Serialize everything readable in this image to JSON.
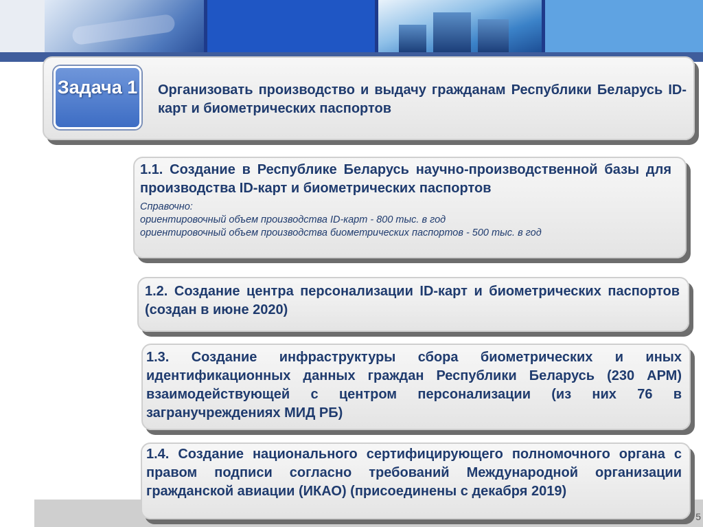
{
  "task": {
    "badge_label": "Задача 1",
    "text": "Организовать производство и выдачу гражданам Республики Беларусь ID-карт и биометрических паспортов"
  },
  "items": [
    {
      "text": "1.1. Создание в Республике Беларусь научно-производственной базы для производства ID-карт и биометрических паспортов",
      "note_title": "Справочно:",
      "note_lines": [
        "ориентировочный объем производства ID-карт  - 800 тыс. в год",
        "ориентировочный объем производства биометрических паспортов - 500 тыс. в год"
      ]
    },
    {
      "text": "1.2. Создание центра персонализации ID-карт и биометрических паспортов (создан в июне 2020)"
    },
    {
      "text": "1.3. Создание инфраструктуры сбора биометрических и иных идентификационных данных граждан Республики Беларусь (230 АРМ) взаимодействующей с центром персонализации (из них 76 в загранучреждениях МИД РБ)"
    },
    {
      "text": "1.4. Создание национального сертифицирующего полномочного органа с правом подписи согласно требований Международной организации гражданской авиации (ИКАО) (присоединены с декабря 2019)"
    }
  ],
  "footer": {
    "page_number": "5"
  },
  "colors": {
    "text": "#1f3b6e",
    "badge": "#3d6dc4",
    "header": "#1e3a8a"
  }
}
